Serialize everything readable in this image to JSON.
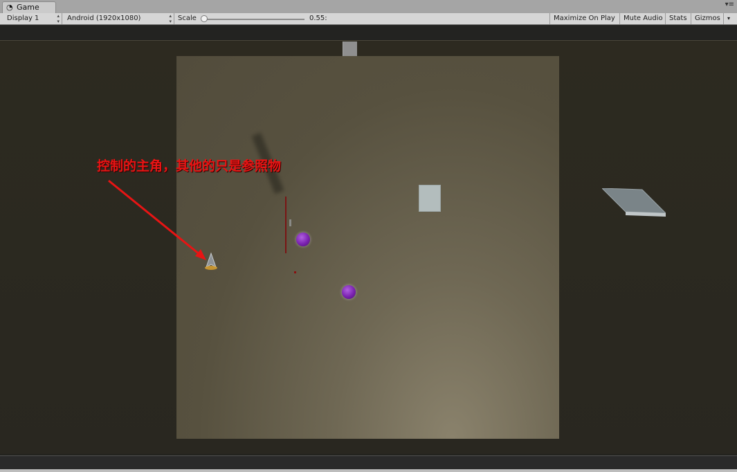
{
  "window": {
    "tab_title": "Game",
    "tab_icon": "game-controller-icon",
    "menu_icon": "panel-menu-icon"
  },
  "toolbar": {
    "display": "Display 1",
    "resolution": "Android (1920x1080)",
    "scale_label": "Scale",
    "scale_value": "0.55:",
    "scale_fraction": 0.0,
    "maximize": "Maximize On Play",
    "mute": "Mute Audio",
    "stats": "Stats",
    "gizmos": "Gizmos"
  },
  "scene": {
    "annotation": "控制的主角，其他的只是参照物",
    "annotation_color": "#e81414",
    "orb_color": "#7a22b0",
    "laser_color": "#7a1414"
  }
}
